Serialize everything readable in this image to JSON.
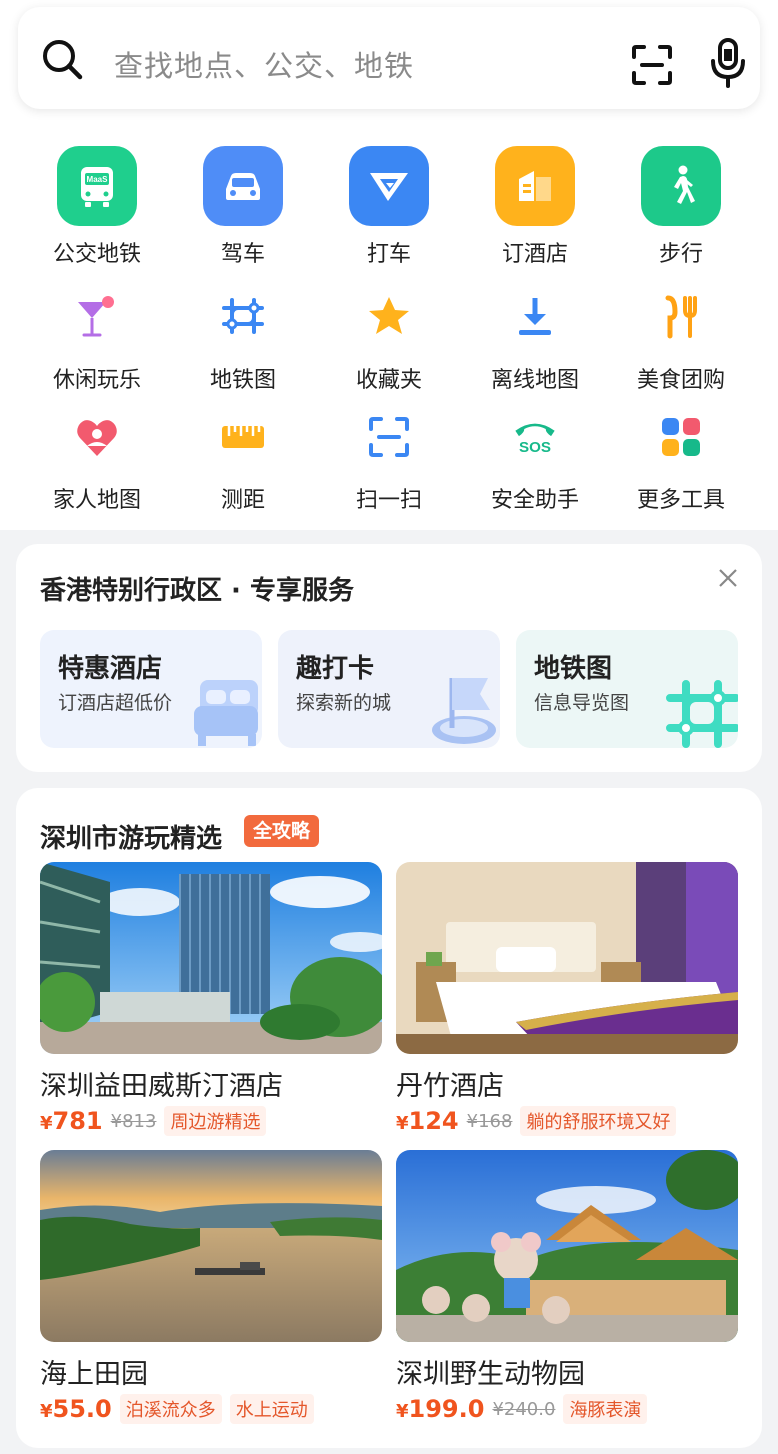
{
  "search": {
    "placeholder": "查找地点、公交、地铁"
  },
  "quick_actions": [
    {
      "label": "公交地铁",
      "icon": "bus-icon",
      "color": "#1fcf8d",
      "badge": "MaaS"
    },
    {
      "label": "驾车",
      "icon": "car-icon",
      "color": "#4f8df7"
    },
    {
      "label": "打车",
      "icon": "taxi-icon",
      "color": "#3b87f3"
    },
    {
      "label": "订酒店",
      "icon": "hotel-icon",
      "color": "#ffb21c"
    },
    {
      "label": "步行",
      "icon": "walk-icon",
      "color": "#1dc98a"
    }
  ],
  "tools": [
    {
      "label": "休闲玩乐",
      "icon": "cocktail-icon"
    },
    {
      "label": "地铁图",
      "icon": "subway-map-icon"
    },
    {
      "label": "收藏夹",
      "icon": "star-icon"
    },
    {
      "label": "离线地图",
      "icon": "download-icon"
    },
    {
      "label": "美食团购",
      "icon": "food-icon"
    },
    {
      "label": "家人地图",
      "icon": "family-icon"
    },
    {
      "label": "测距",
      "icon": "ruler-icon"
    },
    {
      "label": "扫一扫",
      "icon": "scan-icon"
    },
    {
      "label": "安全助手",
      "icon": "sos-icon",
      "text": "SOS"
    },
    {
      "label": "更多工具",
      "icon": "more-tools-icon"
    }
  ],
  "region_services": {
    "title": "香港特别行政区 · 专享服务",
    "items": [
      {
        "title": "特惠酒店",
        "subtitle": "订酒店超低价"
      },
      {
        "title": "趣打卡",
        "subtitle": "探索新的城"
      },
      {
        "title": "地铁图",
        "subtitle": "信息导览图"
      }
    ]
  },
  "picks": {
    "title": "深圳市游玩精选",
    "badge": "全攻略",
    "items": [
      {
        "name": "深圳益田威斯汀酒店",
        "currency": "¥",
        "price": "781",
        "original": "¥813",
        "tags": [
          "周边游精选"
        ]
      },
      {
        "name": "丹竹酒店",
        "currency": "¥",
        "price": "124",
        "original": "¥168",
        "tags": [
          "躺的舒服环境又好"
        ]
      },
      {
        "name": "海上田园",
        "currency": "¥",
        "price": "55.0",
        "original": "",
        "tags": [
          "泊溪流众多",
          "水上运动"
        ]
      },
      {
        "name": "深圳野生动物园",
        "currency": "¥",
        "price": "199.0",
        "original": "¥240.0",
        "tags": [
          "海豚表演"
        ]
      }
    ]
  }
}
